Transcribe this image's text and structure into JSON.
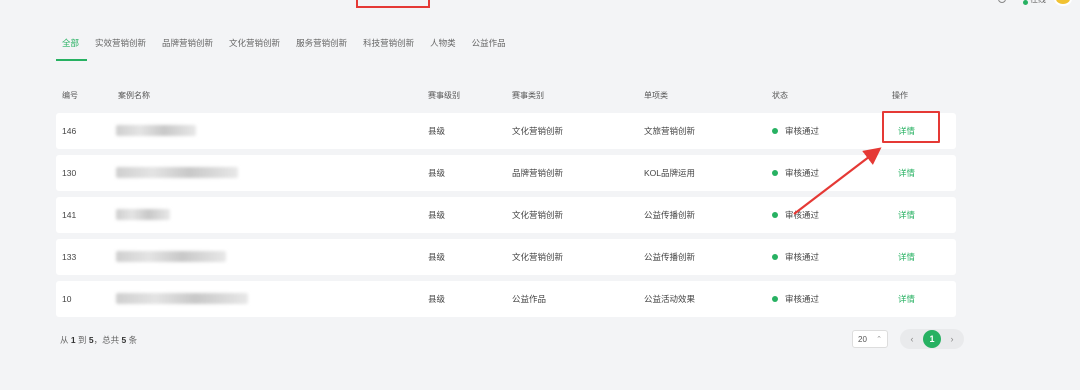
{
  "header": {
    "online_label": "在线",
    "avatar_color": "#f1c232"
  },
  "tabs": [
    {
      "label": "全部",
      "active": true
    },
    {
      "label": "实效营销创新"
    },
    {
      "label": "品牌营销创新"
    },
    {
      "label": "文化营销创新"
    },
    {
      "label": "服务营销创新"
    },
    {
      "label": "科技营销创新"
    },
    {
      "label": "人物类"
    },
    {
      "label": "公益作品"
    }
  ],
  "table": {
    "columns": [
      "编号",
      "案例名称",
      "赛事级别",
      "赛事类别",
      "单项类",
      "状态",
      "操作"
    ],
    "rows": [
      {
        "id": "146",
        "name": "",
        "level": "县级",
        "category": "文化营销创新",
        "item": "文旅营销创新",
        "status": "审核通过",
        "action": "详情"
      },
      {
        "id": "130",
        "name": "",
        "level": "县级",
        "category": "品牌营销创新",
        "item": "KOL品牌运用",
        "status": "审核通过",
        "action": "详情"
      },
      {
        "id": "141",
        "name": "",
        "level": "县级",
        "category": "文化营销创新",
        "item": "公益传播创新",
        "status": "审核通过",
        "action": "详情"
      },
      {
        "id": "133",
        "name": "",
        "level": "县级",
        "category": "文化营销创新",
        "item": "公益传播创新",
        "status": "审核通过",
        "action": "详情"
      },
      {
        "id": "10",
        "name": "",
        "level": "县级",
        "category": "公益作品",
        "item": "公益活动效果",
        "status": "审核通过",
        "action": "详情"
      }
    ]
  },
  "footer": {
    "summary_prefix": "从",
    "summary_from": "1",
    "summary_to_word": "到",
    "summary_to": "5",
    "summary_total_word": "，总共",
    "summary_total": "5",
    "summary_unit": "条",
    "page_size": "20",
    "current_page": "1"
  },
  "colors": {
    "accent": "#27b162",
    "annotation": "#e53935"
  }
}
